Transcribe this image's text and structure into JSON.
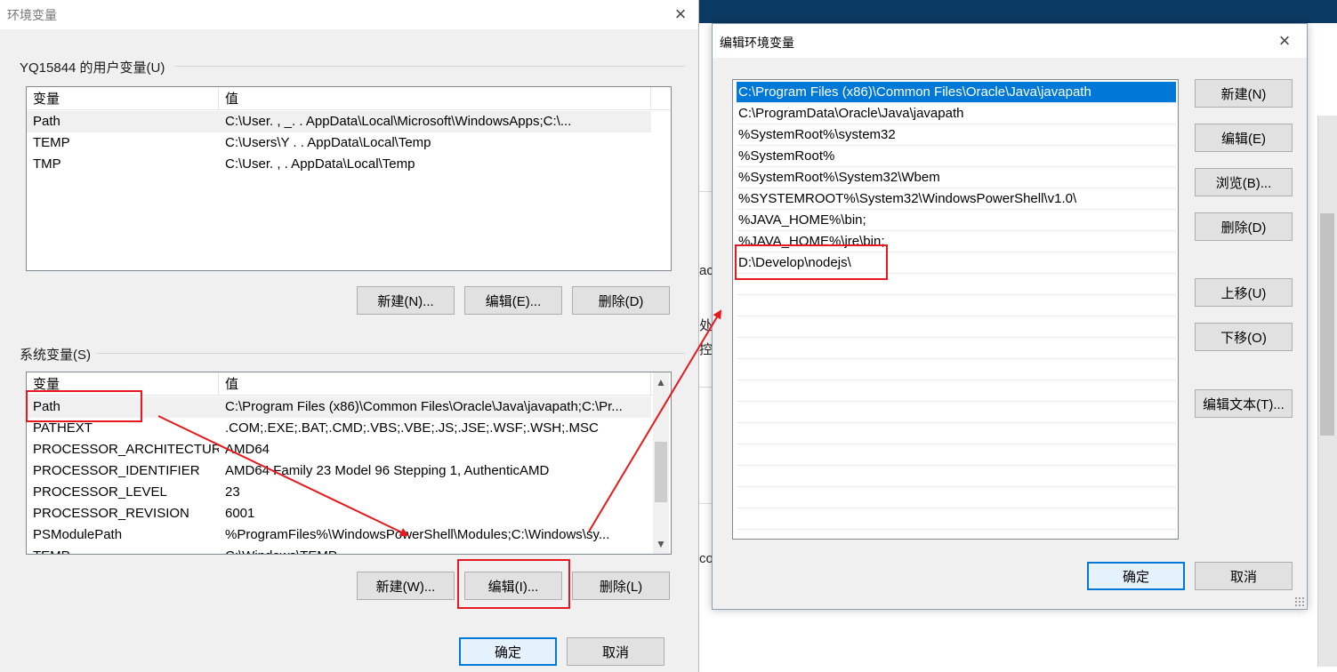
{
  "colors": {
    "annotation": "#e8191e",
    "selection": "#0078d7",
    "accent_border": "#0078d7"
  },
  "left_dialog": {
    "title": "环境变量",
    "close_icon": "×",
    "user_group": {
      "label": "YQ15844 的用户变量(U)",
      "columns": [
        "变量",
        "值"
      ],
      "rows": [
        {
          "name": "Path",
          "value": "C:\\User. , _. . AppData\\Local\\Microsoft\\WindowsApps;C:\\..."
        },
        {
          "name": "TEMP",
          "value": "C:\\Users\\Y . . AppData\\Local\\Temp"
        },
        {
          "name": "TMP",
          "value": "C:\\User. , . AppData\\Local\\Temp"
        }
      ],
      "buttons": {
        "new": "新建(N)...",
        "edit": "编辑(E)...",
        "delete": "删除(D)"
      }
    },
    "system_group": {
      "label": "系统变量(S)",
      "columns": [
        "变量",
        "值"
      ],
      "rows": [
        {
          "name": "Path",
          "value": "C:\\Program Files (x86)\\Common Files\\Oracle\\Java\\javapath;C:\\Pr..."
        },
        {
          "name": "PATHEXT",
          "value": ".COM;.EXE;.BAT;.CMD;.VBS;.VBE;.JS;.JSE;.WSF;.WSH;.MSC"
        },
        {
          "name": "PROCESSOR_ARCHITECTURE",
          "value": "AMD64"
        },
        {
          "name": "PROCESSOR_IDENTIFIER",
          "value": "AMD64 Family 23 Model 96 Stepping 1, AuthenticAMD"
        },
        {
          "name": "PROCESSOR_LEVEL",
          "value": "23"
        },
        {
          "name": "PROCESSOR_REVISION",
          "value": "6001"
        },
        {
          "name": "PSModulePath",
          "value": "%ProgramFiles%\\WindowsPowerShell\\Modules;C:\\Windows\\sy..."
        },
        {
          "name": "TEMP",
          "value": "C:\\Windows\\TEMP"
        }
      ],
      "buttons": {
        "new": "新建(W)...",
        "edit": "编辑(I)...",
        "delete": "删除(L)"
      }
    },
    "footer": {
      "ok": "确定",
      "cancel": "取消"
    }
  },
  "right_dialog": {
    "title": "编辑环境变量",
    "close_icon": "×",
    "paths": [
      "C:\\Program Files (x86)\\Common Files\\Oracle\\Java\\javapath",
      "C:\\ProgramData\\Oracle\\Java\\javapath",
      "%SystemRoot%\\system32",
      "%SystemRoot%",
      "%SystemRoot%\\System32\\Wbem",
      "%SYSTEMROOT%\\System32\\WindowsPowerShell\\v1.0\\",
      "%JAVA_HOME%\\bin;",
      "%JAVA_HOME%\\jre\\bin;",
      "D:\\Develop\\nodejs\\"
    ],
    "buttons": {
      "new": "新建(N)",
      "edit": "编辑(E)",
      "browse": "浏览(B)...",
      "delete": "删除(D)",
      "move_up": "上移(U)",
      "move_down": "下移(O)",
      "edit_text": "编辑文本(T)...",
      "ok": "确定",
      "cancel": "取消"
    }
  },
  "background_fragments": [
    "ac",
    "处",
    "控",
    "co"
  ]
}
